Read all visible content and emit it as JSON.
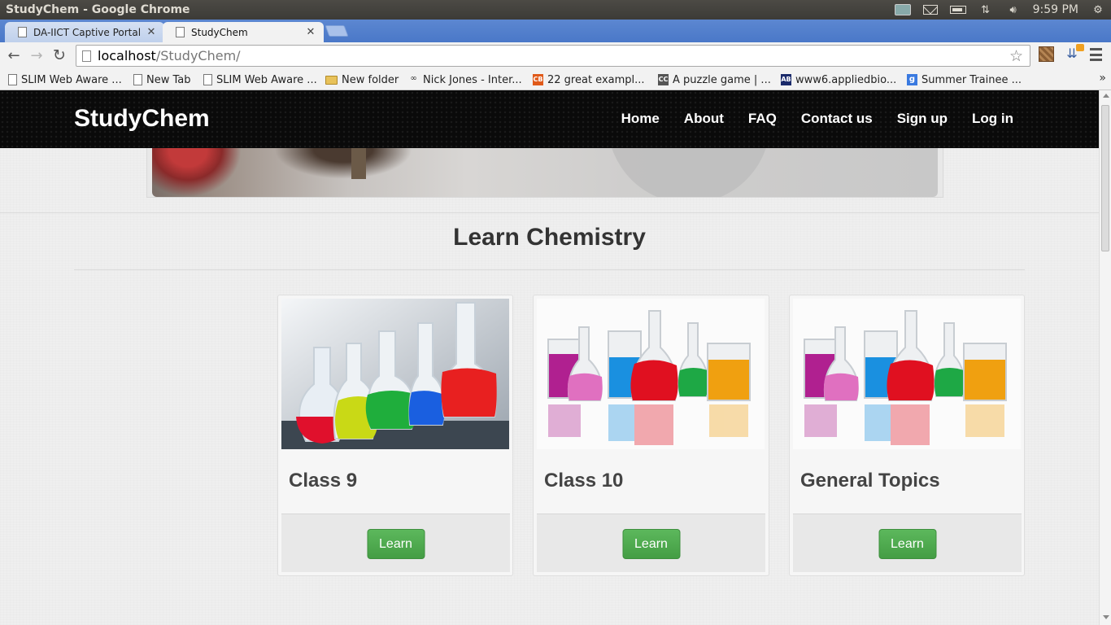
{
  "os": {
    "window_title": "StudyChem - Google Chrome",
    "clock": "9:59 PM"
  },
  "tabs": [
    {
      "label": "DA-IICT Captive Portal",
      "active": false
    },
    {
      "label": "StudyChem",
      "active": true
    }
  ],
  "toolbar": {
    "url_host": "localhost",
    "url_path": "/StudyChem/"
  },
  "bookmarks": [
    {
      "label": "SLIM Web Aware ...",
      "icon": "page-icon"
    },
    {
      "label": "New Tab",
      "icon": "page-icon"
    },
    {
      "label": "SLIM Web Aware ...",
      "icon": "page-icon"
    },
    {
      "label": "New folder",
      "icon": "folder-icon"
    },
    {
      "label": "Nick Jones - Inter...",
      "icon": "site-icon"
    },
    {
      "label": "22 great exampl...",
      "icon": "site-icon"
    },
    {
      "label": "A puzzle game | ...",
      "icon": "site-icon"
    },
    {
      "label": "www6.appliedbio...",
      "icon": "site-icon"
    },
    {
      "label": "Summer Trainee ...",
      "icon": "google-icon"
    }
  ],
  "site": {
    "brand": "StudyChem",
    "nav": [
      "Home",
      "About",
      "FAQ",
      "Contact us",
      "Sign up",
      "Log in"
    ],
    "section_title": "Learn Chemistry",
    "cards": [
      {
        "title": "Class 9",
        "button": "Learn"
      },
      {
        "title": "Class 10",
        "button": "Learn"
      },
      {
        "title": "General Topics",
        "button": "Learn"
      }
    ]
  },
  "colors": {
    "navbar": "#0a0a0a",
    "button_green": "#5cb85c",
    "tabstrip_blue": "#4a78c8"
  }
}
